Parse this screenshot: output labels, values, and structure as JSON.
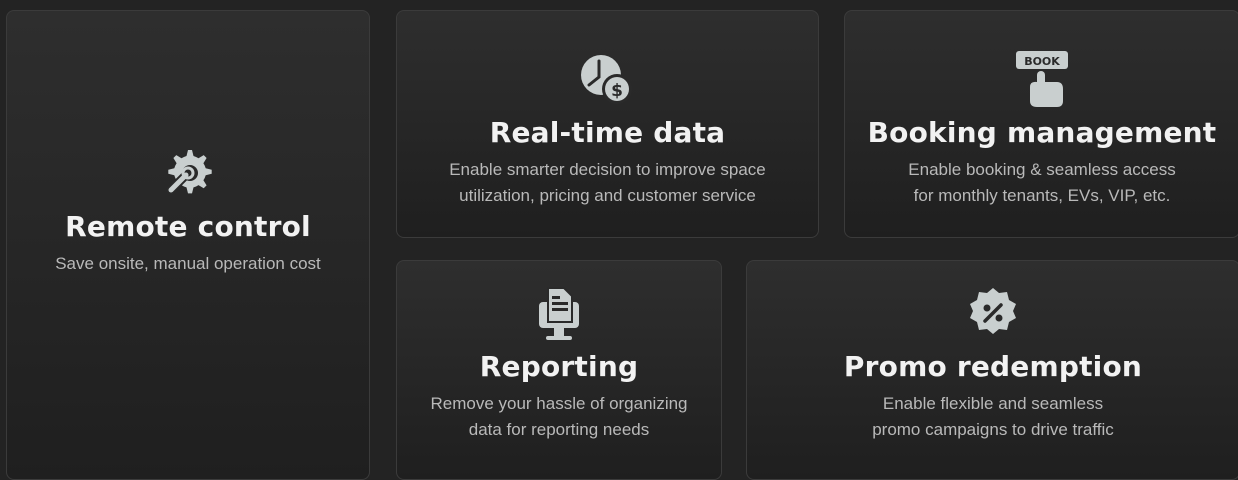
{
  "cards": {
    "remote": {
      "icon": "gear-wrench-icon",
      "title": "Remote control",
      "description": "Save onsite, manual operation cost"
    },
    "realtime": {
      "icon": "clock-dollar-icon",
      "title": "Real-time data",
      "description": "Enable smarter decision to improve space\nutilization, pricing and customer service"
    },
    "booking": {
      "icon": "book-button-icon",
      "icon_text": "BOOK",
      "title": "Booking management",
      "description": "Enable booking & seamless access\nfor monthly tenants, EVs, VIP, etc."
    },
    "reporting": {
      "icon": "report-monitor-icon",
      "title": "Reporting",
      "description": "Remove your hassle of organizing\ndata for reporting needs"
    },
    "promo": {
      "icon": "percent-badge-icon",
      "title": "Promo redemption",
      "description": "Enable flexible and seamless\npromo campaigns to drive traffic"
    }
  },
  "colors": {
    "background": "#232323",
    "icon": "#c9cfcf",
    "title": "#f2f2f2",
    "description": "#b9b9b9"
  }
}
